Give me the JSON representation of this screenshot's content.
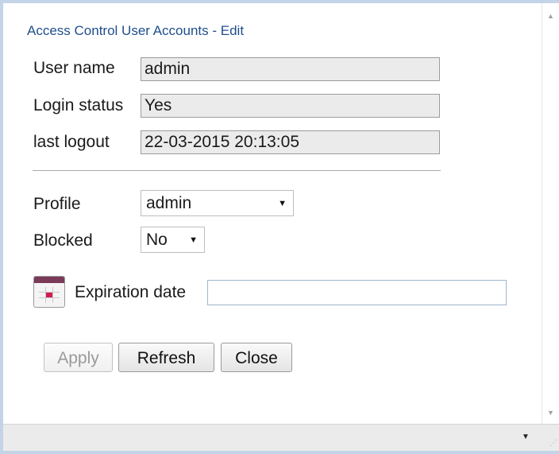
{
  "dialog": {
    "title": "Access Control User Accounts - Edit"
  },
  "info": {
    "username_label": "User name",
    "username_value": "admin",
    "login_status_label": "Login status",
    "login_status_value": "Yes",
    "last_logout_label": "last logout",
    "last_logout_value": "22-03-2015 20:13:05"
  },
  "settings": {
    "profile_label": "Profile",
    "profile_value": "admin",
    "blocked_label": "Blocked",
    "blocked_value": "No",
    "expiration_label": "Expiration date",
    "expiration_value": ""
  },
  "buttons": {
    "apply": "Apply",
    "refresh": "Refresh",
    "close": "Close"
  },
  "icons": {
    "calendar": "calendar-icon",
    "scroll_up": "scroll-up-arrow-icon",
    "scroll_down": "scroll-down-arrow-icon",
    "bottom_menu": "dropdown-arrow-icon",
    "resize": "resize-grip-icon"
  },
  "colors": {
    "frame_border": "#c3d4e8",
    "title_text": "#1f4e8c",
    "readonly_bg": "#ebebeb",
    "calendar_header": "#7a3b58",
    "calendar_mark": "#d11d4e"
  }
}
